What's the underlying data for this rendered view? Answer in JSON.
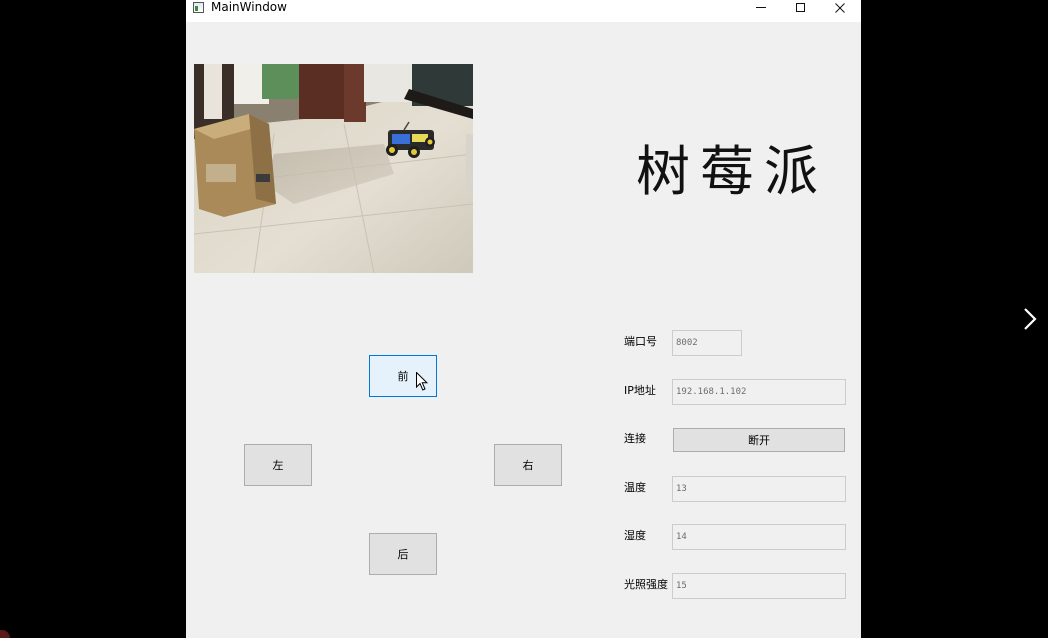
{
  "window": {
    "title": "MainWindow"
  },
  "header": {
    "brand": "树莓派"
  },
  "controls": {
    "forward": "前",
    "left": "左",
    "right": "右",
    "back": "后"
  },
  "form": {
    "port_label": "端口号",
    "port_value": "8002",
    "ip_label": "IP地址",
    "ip_value": "192.168.1.102",
    "connect_label": "连接",
    "disconnect_button": "断开",
    "temperature_label": "温度",
    "temperature_value": "13",
    "humidity_label": "湿度",
    "humidity_value": "14",
    "light_label": "光照强度",
    "light_value": "15"
  },
  "icons": {
    "app": "app-icon",
    "minimize": "minimize-icon",
    "maximize": "maximize-icon",
    "close": "close-icon",
    "cursor": "mouse-cursor-icon",
    "next": "chevron-right-icon"
  },
  "colors": {
    "window_bg": "#f0f0f0",
    "button_bg": "#e1e1e1",
    "hover_button_bg": "#e5f1fb",
    "hover_border": "#0078d7",
    "field_text": "#6d6d6d"
  }
}
